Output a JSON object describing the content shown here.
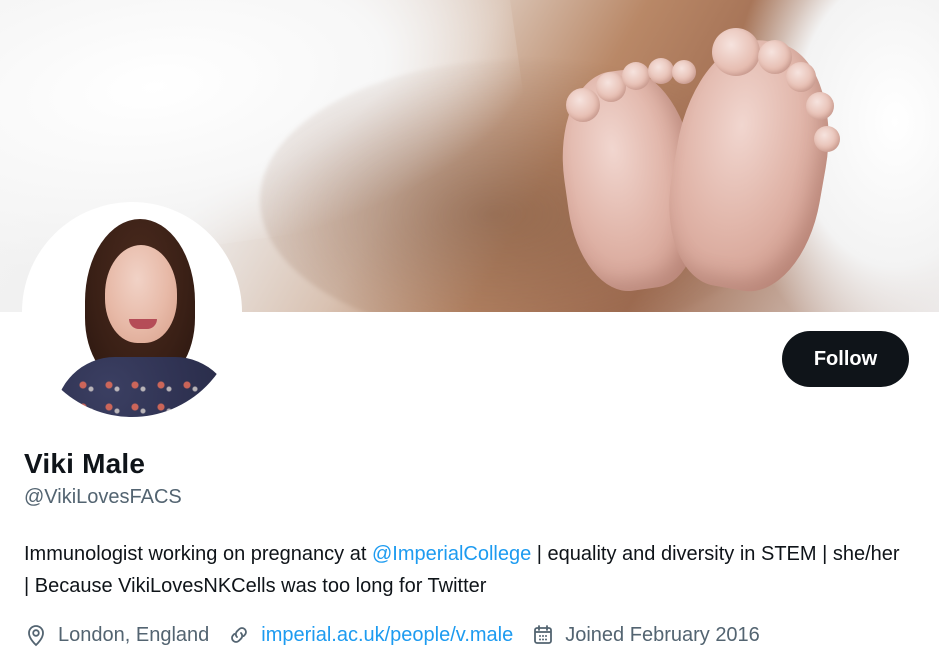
{
  "profile": {
    "name": "Viki Male",
    "handle": "@VikiLovesFACS",
    "follow_label": "Follow",
    "bio": {
      "prefix": "Immunologist working on pregnancy at ",
      "mention": "@ImperialCollege",
      "suffix": " | equality and diversity in STEM | she/her | Because VikiLovesNKCells was too long for Twitter"
    },
    "meta": {
      "location": "London, England",
      "website": "imperial.ac.uk/people/v.male",
      "joined": "Joined February 2016"
    }
  },
  "icons": {
    "location": "location-pin-icon",
    "link": "link-icon",
    "joined": "calendar-icon"
  },
  "colors": {
    "text_primary": "#0f1419",
    "text_secondary": "#536471",
    "link": "#1d9bf0",
    "follow_bg": "#0f1419",
    "follow_text": "#ffffff"
  }
}
